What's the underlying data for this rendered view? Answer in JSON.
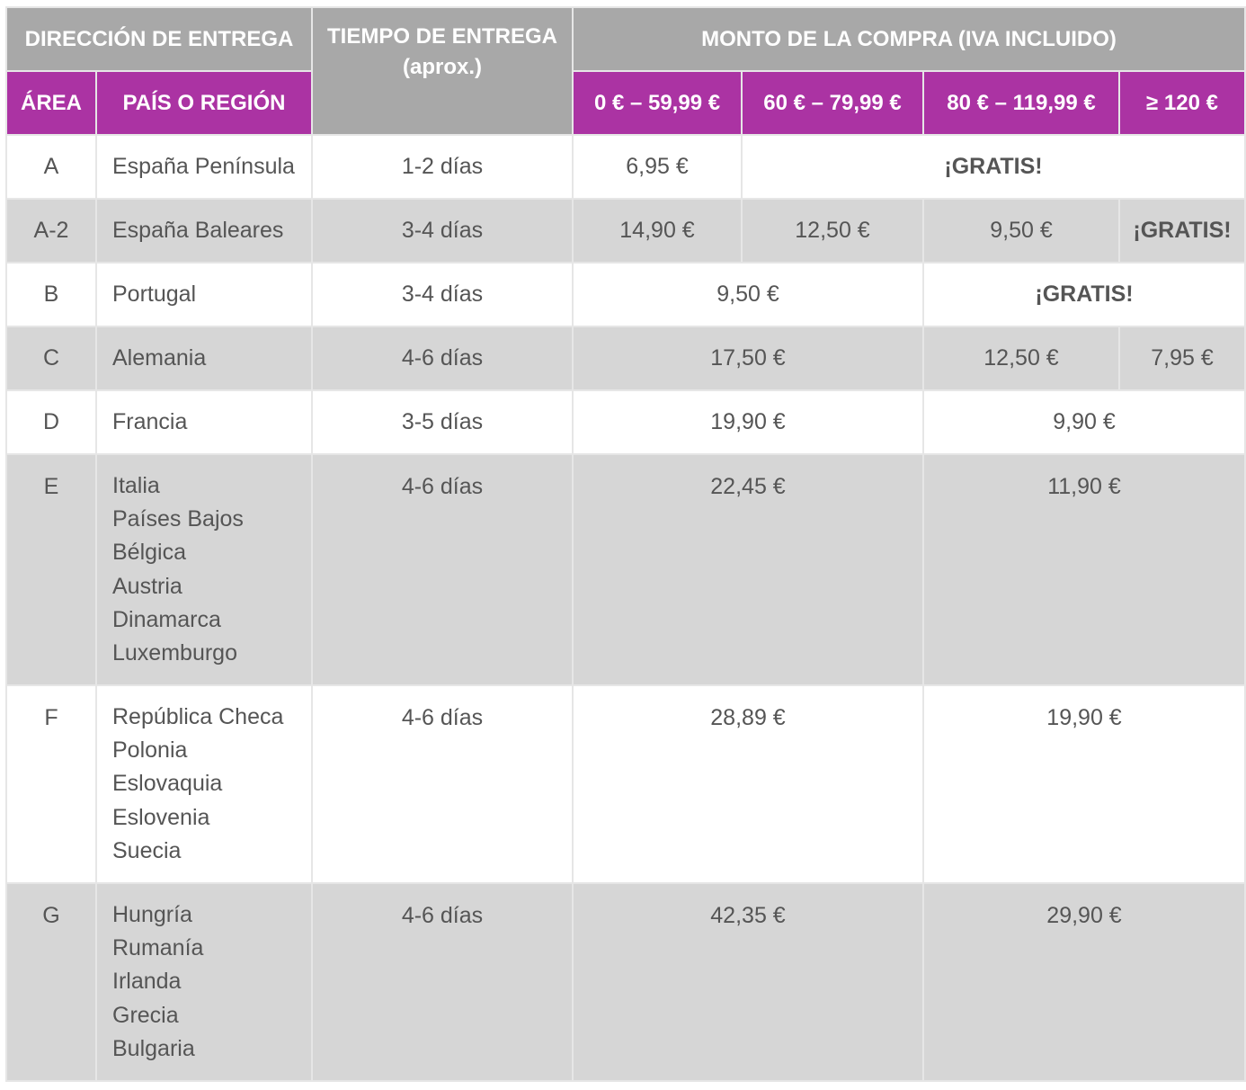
{
  "header": {
    "direccion": "DIRECCIÓN DE ENTREGA",
    "tiempo_line1": "TIEMPO DE ENTREGA",
    "tiempo_line2": "(aprox.)",
    "monto": "MONTO DE LA COMPRA (IVA INCLUIDO)",
    "area": "ÁREA",
    "pais": "PAÍS O REGIÓN",
    "ranges": [
      "0 € – 59,99 €",
      "60 € – 79,99 €",
      "80 € – 119,99 €",
      "≥ 120 €"
    ]
  },
  "rows": [
    {
      "area": "A",
      "countries": [
        "España Península"
      ],
      "time": "1-2 días",
      "prices": [
        "6,95 €",
        "¡GRATIS!"
      ]
    },
    {
      "area": "A-2",
      "countries": [
        "España Baleares"
      ],
      "time": "3-4 días",
      "prices": [
        "14,90 €",
        "12,50 €",
        "9,50 €",
        "¡GRATIS!"
      ]
    },
    {
      "area": "B",
      "countries": [
        "Portugal"
      ],
      "time": "3-4 días",
      "prices": [
        "9,50 €",
        "¡GRATIS!"
      ]
    },
    {
      "area": "C",
      "countries": [
        "Alemania"
      ],
      "time": "4-6 días",
      "prices": [
        "17,50 €",
        "12,50 €",
        "7,95 €"
      ]
    },
    {
      "area": "D",
      "countries": [
        "Francia"
      ],
      "time": "3-5 días",
      "prices": [
        "19,90 €",
        "9,90 €"
      ]
    },
    {
      "area": "E",
      "countries": [
        "Italia",
        "Países Bajos",
        "Bélgica",
        "Austria",
        "Dinamarca",
        "Luxemburgo"
      ],
      "time": "4-6 días",
      "prices": [
        "22,45 €",
        "11,90 €"
      ]
    },
    {
      "area": "F",
      "countries": [
        "República Checa",
        "Polonia",
        "Eslovaquia",
        "Eslovenia",
        "Suecia"
      ],
      "time": "4-6 días",
      "prices": [
        "28,89 €",
        "19,90 €"
      ]
    },
    {
      "area": "G",
      "countries": [
        "Hungría",
        "Rumanía",
        "Irlanda",
        "Grecia",
        "Bulgaria"
      ],
      "time": "4-6 días",
      "prices": [
        "42,35 €",
        "29,90 €"
      ]
    }
  ],
  "colors": {
    "header_gray": "#a8a8a8",
    "header_magenta": "#ab33a3",
    "row_gray": "#d6d6d6",
    "text": "#555555"
  }
}
